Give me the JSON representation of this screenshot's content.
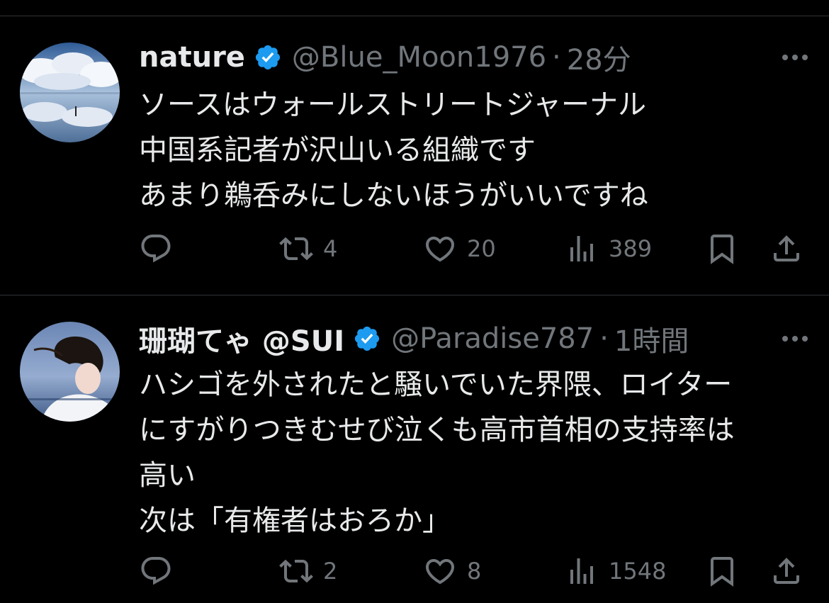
{
  "tweets": [
    {
      "name": "nature",
      "handle": "@Blue_Moon1976",
      "separator": "·",
      "time": "28分",
      "lines": [
        "ソースはウォールストリートジャーナル",
        "中国系記者が沢山いる組織です",
        "あまり鵜呑みにしないほうがいいですね"
      ],
      "stats": {
        "retweets": "4",
        "likes": "20",
        "views": "389"
      }
    },
    {
      "name": "珊瑚てゃ @SUI",
      "handle": "@Paradise787",
      "separator": "·",
      "time": "1時間",
      "lines": [
        "ハシゴを外されたと騒いでいた界隈、ロイター",
        "にすがりつきむせび泣くも高市首相の支持率は",
        "高い",
        "次は「有権者はおろか」"
      ],
      "stats": {
        "retweets": "2",
        "likes": "8",
        "views": "1548"
      }
    }
  ],
  "colors": {
    "background": "#000000",
    "text": "#e7e9ea",
    "muted": "#71767b",
    "verified": "#1d9bf0",
    "divider": "#2f3336"
  },
  "icons": [
    "verified-badge-icon",
    "more-icon",
    "reply-icon",
    "retweet-icon",
    "like-icon",
    "views-icon",
    "bookmark-icon",
    "share-icon"
  ]
}
